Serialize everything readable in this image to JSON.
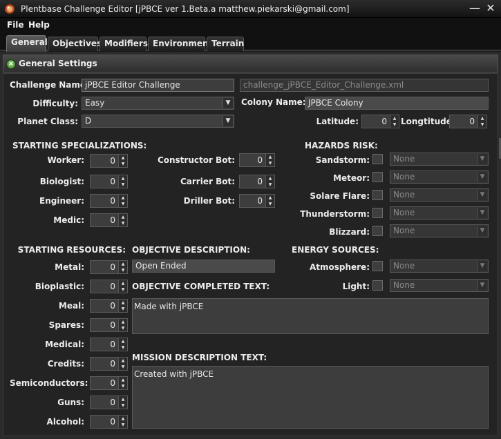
{
  "window": {
    "title": "Plentbase Challenge Editor [jPBCE ver 1.Beta.a matthew.piekarski@gmail.com]",
    "minimize_glyph": "—",
    "close_glyph": "✕"
  },
  "menubar": {
    "items": [
      "File",
      "Help"
    ]
  },
  "tabs": [
    {
      "label": "General",
      "active": true
    },
    {
      "label": "Objectives",
      "active": false
    },
    {
      "label": "Modifiers",
      "active": false
    },
    {
      "label": "Environment",
      "active": false
    },
    {
      "label": "Terrain",
      "active": false
    }
  ],
  "section": {
    "title": "General Settings",
    "icon": "collapse-icon"
  },
  "general": {
    "challenge_name_label": "Challenge Name:",
    "challenge_name_value": "jPBCE Editor Challenge",
    "filename_value": "challenge_jPBCE_Editor_Challenge.xml",
    "difficulty_label": "Difficulty:",
    "difficulty_value": "Easy",
    "colony_name_label": "Colony Name:",
    "colony_name_value": "JPBCE Colony",
    "planet_class_label": "Planet Class:",
    "planet_class_value": "D",
    "latitude_label": "Latitude:",
    "latitude_value": "0",
    "longitude_label": "Longtitude:",
    "longitude_value": "0"
  },
  "specializations": {
    "heading": "STARTING SPECIALIZATIONS:",
    "items": [
      {
        "label": "Worker:",
        "value": "0"
      },
      {
        "label": "Biologist:",
        "value": "0"
      },
      {
        "label": "Engineer:",
        "value": "0"
      },
      {
        "label": "Medic:",
        "value": "0"
      }
    ],
    "bots": [
      {
        "label": "Constructor Bot:",
        "value": "0"
      },
      {
        "label": "Carrier Bot:",
        "value": "0"
      },
      {
        "label": "Driller Bot:",
        "value": "0"
      }
    ]
  },
  "hazards": {
    "heading": "HAZARDS RISK:",
    "items": [
      {
        "label": "Sandstorm:",
        "value": "None"
      },
      {
        "label": "Meteor:",
        "value": "None"
      },
      {
        "label": "Solare Flare:",
        "value": "None"
      },
      {
        "label": "Thunderstorm:",
        "value": "None"
      },
      {
        "label": "Blizzard:",
        "value": "None"
      }
    ]
  },
  "resources": {
    "heading": "STARTING RESOURCES:",
    "items": [
      {
        "label": "Metal:",
        "value": "0"
      },
      {
        "label": "Bioplastic:",
        "value": "0"
      },
      {
        "label": "Meal:",
        "value": "0"
      },
      {
        "label": "Spares:",
        "value": "0"
      },
      {
        "label": "Medical:",
        "value": "0"
      },
      {
        "label": "Credits:",
        "value": "0"
      },
      {
        "label": "Semiconductors:",
        "value": "0"
      },
      {
        "label": "Guns:",
        "value": "0"
      },
      {
        "label": "Alcohol:",
        "value": "0"
      }
    ]
  },
  "objective": {
    "description_heading": "OBJECTIVE DESCRIPTION:",
    "description_value": "Open Ended",
    "completed_heading": "OBJECTIVE COMPLETED TEXT:",
    "completed_value": "Made with jPBCE",
    "mission_heading": "MISSION DESCRIPTION TEXT:",
    "mission_value": "Created with jPBCE"
  },
  "energy": {
    "heading": "ENERGY SOURCES:",
    "items": [
      {
        "label": "Atmosphere:",
        "value": "None"
      },
      {
        "label": "Light:",
        "value": "None"
      }
    ]
  }
}
